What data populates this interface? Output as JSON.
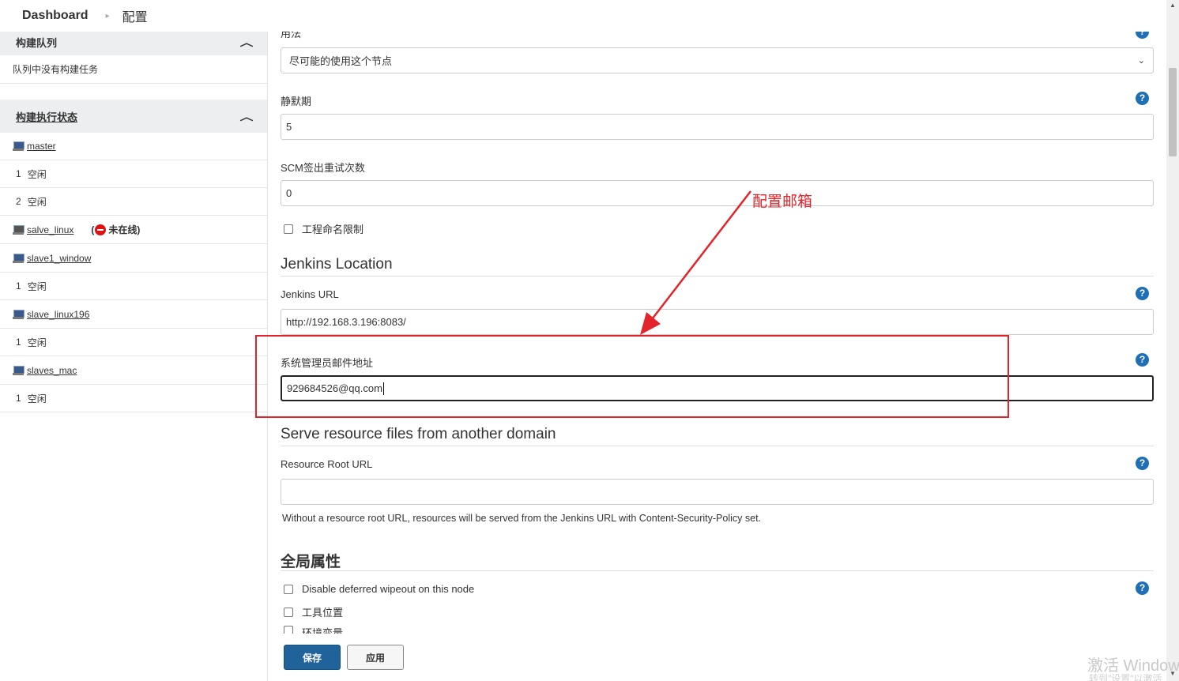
{
  "breadcrumb": {
    "root": "Dashboard",
    "separator": "›",
    "current": "配置"
  },
  "sidebar": {
    "queue": {
      "title": "构建队列",
      "empty_text": "队列中没有构建任务"
    },
    "executors": {
      "title": "构建执行状态",
      "nodes": [
        {
          "name": "master",
          "offline": false,
          "slots": [
            {
              "num": "1",
              "status": "空闲"
            },
            {
              "num": "2",
              "status": "空闲"
            }
          ]
        },
        {
          "name": "salve_linux",
          "offline": true,
          "offline_label": "(",
          "offline_text": "未在线)",
          "slots": []
        },
        {
          "name": "slave1_window",
          "offline": false,
          "slots": [
            {
              "num": "1",
              "status": "空闲"
            }
          ]
        },
        {
          "name": "slave_linux196",
          "offline": false,
          "slots": [
            {
              "num": "1",
              "status": "空闲"
            }
          ]
        },
        {
          "name": "slaves_mac",
          "offline": false,
          "slots": [
            {
              "num": "1",
              "status": "空闲"
            }
          ]
        }
      ]
    }
  },
  "form": {
    "usage": {
      "label": "用法",
      "value": "尽可能的使用这个节点"
    },
    "quiet_period": {
      "label": "静默期",
      "value": "5"
    },
    "scm_retry": {
      "label": "SCM签出重试次数",
      "value": "0"
    },
    "project_naming": {
      "label": "工程命名限制",
      "checked": false
    },
    "jenkins_location": {
      "title": "Jenkins Location",
      "url_label": "Jenkins URL",
      "url_value": "http://192.168.3.196:8083/",
      "email_label": "系统管理员邮件地址",
      "email_value": "929684526@qq.com"
    },
    "resource_domain": {
      "title": "Serve resource files from another domain",
      "label": "Resource Root URL",
      "value": "",
      "hint": "Without a resource root URL, resources will be served from the Jenkins URL with Content-Security-Policy set."
    },
    "global_props": {
      "title": "全局属性",
      "options": [
        {
          "label": "Disable deferred wipeout on this node",
          "checked": false
        },
        {
          "label": "工具位置",
          "checked": false
        },
        {
          "label": "环境变量",
          "checked": false
        }
      ]
    },
    "help_symbol": "?"
  },
  "buttons": {
    "save": "保存",
    "apply": "应用"
  },
  "annotation": {
    "text": "配置邮箱",
    "color": "#e3242b"
  },
  "watermark": {
    "line1": "激活 Windows",
    "line2": "转到\"设置\"以激活"
  }
}
